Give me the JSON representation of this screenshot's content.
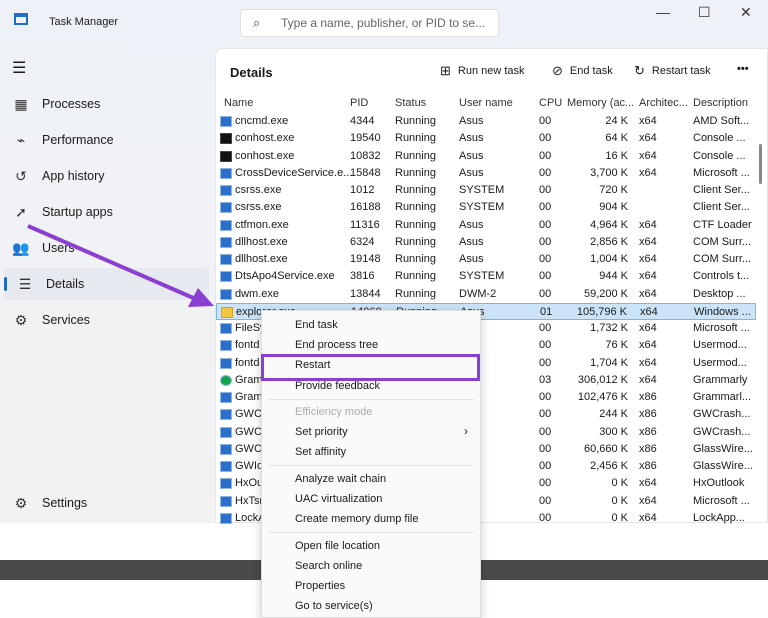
{
  "title": "Task Manager",
  "search_placeholder": "Type a name, publisher, or PID to se...",
  "nav": [
    {
      "label": "Processes",
      "icon": "processes-icon",
      "g": "▦"
    },
    {
      "label": "Performance",
      "icon": "performance-icon",
      "g": "⌁"
    },
    {
      "label": "App history",
      "icon": "history-icon",
      "g": "↺"
    },
    {
      "label": "Startup apps",
      "icon": "startup-icon",
      "g": "➚"
    },
    {
      "label": "Users",
      "icon": "users-icon",
      "g": "👥"
    },
    {
      "label": "Details",
      "icon": "details-icon",
      "g": "☰"
    },
    {
      "label": "Services",
      "icon": "services-icon",
      "g": "⚙"
    }
  ],
  "settings": "Settings",
  "panel_title": "Details",
  "toolbar": {
    "run": "Run new task",
    "end": "End task",
    "restart": "Restart task",
    "more": "•••"
  },
  "columns": [
    "Name",
    "PID",
    "Status",
    "User name",
    "CPU",
    "Memory (ac...",
    "Architec...",
    "Description"
  ],
  "rows": [
    [
      "cncmd.exe",
      "4344",
      "Running",
      "Asus",
      "00",
      "24 K",
      "x64",
      "AMD Soft..."
    ],
    [
      "conhost.exe",
      "19540",
      "Running",
      "Asus",
      "00",
      "64 K",
      "x64",
      "Console ..."
    ],
    [
      "conhost.exe",
      "10832",
      "Running",
      "Asus",
      "00",
      "16 K",
      "x64",
      "Console ..."
    ],
    [
      "CrossDeviceService.e...",
      "15848",
      "Running",
      "Asus",
      "00",
      "3,700 K",
      "x64",
      "Microsoft ..."
    ],
    [
      "csrss.exe",
      "1012",
      "Running",
      "SYSTEM",
      "00",
      "720 K",
      "",
      "Client Ser..."
    ],
    [
      "csrss.exe",
      "16188",
      "Running",
      "SYSTEM",
      "00",
      "904 K",
      "",
      "Client Ser..."
    ],
    [
      "ctfmon.exe",
      "11316",
      "Running",
      "Asus",
      "00",
      "4,964 K",
      "x64",
      "CTF Loader"
    ],
    [
      "dllhost.exe",
      "6324",
      "Running",
      "Asus",
      "00",
      "2,856 K",
      "x64",
      "COM Surr..."
    ],
    [
      "dllhost.exe",
      "19148",
      "Running",
      "Asus",
      "00",
      "1,004 K",
      "x64",
      "COM Surr..."
    ],
    [
      "DtsApo4Service.exe",
      "3816",
      "Running",
      "SYSTEM",
      "00",
      "944 K",
      "x64",
      "Controls t..."
    ],
    [
      "dwm.exe",
      "13844",
      "Running",
      "DWM-2",
      "00",
      "59,200 K",
      "x64",
      "Desktop ..."
    ],
    [
      "explorer.exe",
      "14060",
      "Running",
      "Asus",
      "01",
      "105,796 K",
      "x64",
      "Windows ..."
    ],
    [
      "FileSy",
      "",
      "",
      "EM",
      "00",
      "1,732 K",
      "x64",
      "Microsoft ..."
    ],
    [
      "fontd",
      "",
      "",
      "D-0",
      "00",
      "76 K",
      "x64",
      "Usermod..."
    ],
    [
      "fontd",
      "",
      "",
      "D-2",
      "00",
      "1,704 K",
      "x64",
      "Usermod..."
    ],
    [
      "Gram",
      "",
      "",
      "",
      "03",
      "306,012 K",
      "x64",
      "Grammarly"
    ],
    [
      "Gram",
      "",
      "",
      "",
      "00",
      "102,476 K",
      "x86",
      "Grammarl..."
    ],
    [
      "GWCr",
      "",
      "",
      "EM",
      "00",
      "244 K",
      "x86",
      "GWCrash..."
    ],
    [
      "GWCr",
      "",
      "",
      "",
      "00",
      "300 K",
      "x86",
      "GWCrash..."
    ],
    [
      "GWCt",
      "",
      "",
      "EM",
      "00",
      "60,660 K",
      "x86",
      "GlassWire..."
    ],
    [
      "GWId",
      "",
      "",
      "",
      "00",
      "2,456 K",
      "x86",
      "GlassWire..."
    ],
    [
      "HxOu",
      "",
      "",
      "",
      "00",
      "0 K",
      "x64",
      "HxOutlook"
    ],
    [
      "HxTsr",
      "",
      "",
      "",
      "00",
      "0 K",
      "x64",
      "Microsoft ..."
    ],
    [
      "LockA",
      "",
      "",
      "",
      "00",
      "0 K",
      "x64",
      "LockApp..."
    ]
  ],
  "menu": [
    "End task",
    "End process tree",
    "Restart",
    "Provide feedback",
    "Efficiency mode",
    "Set priority",
    "Set affinity",
    "Analyze wait chain",
    "UAC virtualization",
    "Create memory dump file",
    "Open file location",
    "Search online",
    "Properties",
    "Go to service(s)"
  ],
  "accent": "#8a3fd1"
}
